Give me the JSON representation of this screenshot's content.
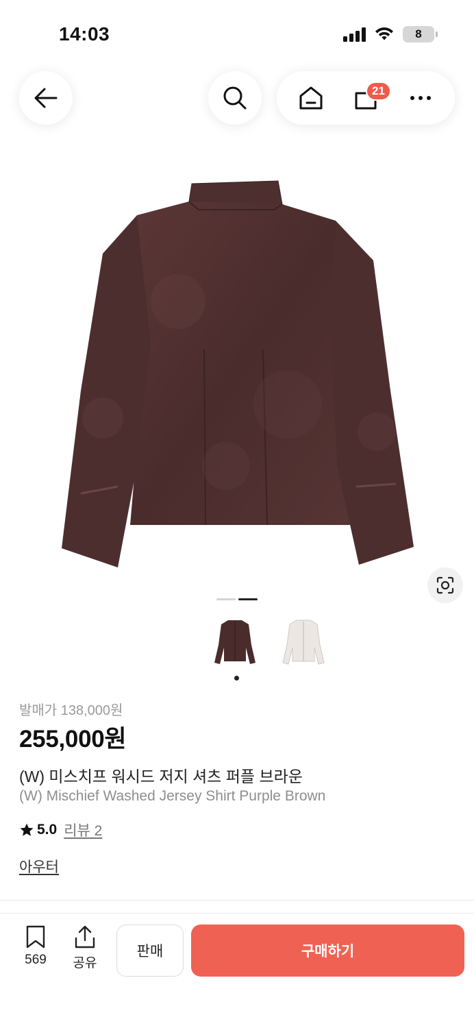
{
  "status": {
    "time": "14:03",
    "battery": "8"
  },
  "nav": {
    "cart_count": "21"
  },
  "product": {
    "release_price": "발매가 138,000원",
    "price": "255,000원",
    "name_ko": "(W) 미스치프 워시드 저지 셔츠 퍼플 브라운",
    "name_en": "(W) Mischief Washed Jersey Shirt Purple Brown",
    "rating": "5.0",
    "review_link": "리뷰 2",
    "category": "아우터",
    "image_page": {
      "current": 2,
      "total": 2
    },
    "thumbnails": [
      "brown-jacket-thumb",
      "ivory-jacket-thumb"
    ]
  },
  "bottom": {
    "wishlist_count": "569",
    "share_label": "공유",
    "sell_label": "판매",
    "buy_label": "구매하기"
  },
  "colors": {
    "accent": "#EF6253",
    "badge": "#EF5A4A",
    "jacket": "#4A2C2C"
  }
}
